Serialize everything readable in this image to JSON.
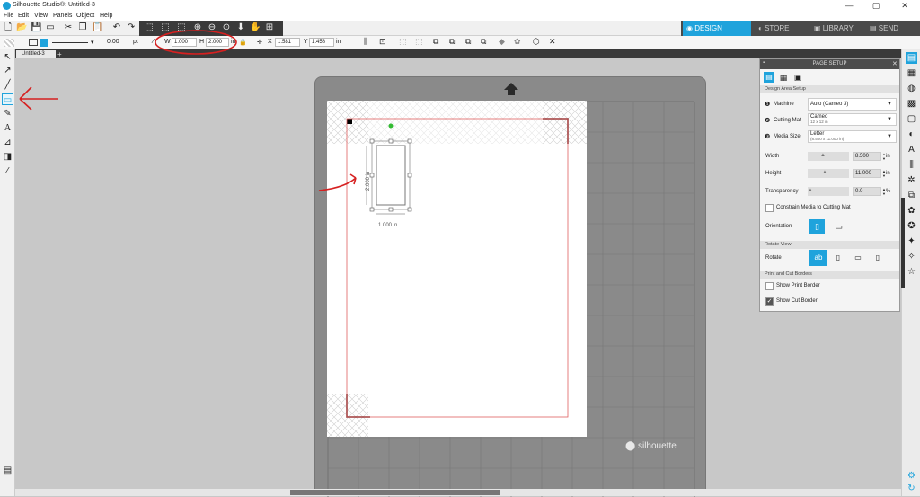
{
  "window": {
    "title": "Silhouette Studio®: Untitled-3",
    "controls": [
      "—",
      "▢",
      "✕"
    ]
  },
  "menu": [
    "File",
    "Edit",
    "View",
    "Panels",
    "Object",
    "Help"
  ],
  "nav_tabs": [
    {
      "label": "DESIGN",
      "active": true
    },
    {
      "label": "STORE",
      "active": false
    },
    {
      "label": "LIBRARY",
      "active": false
    },
    {
      "label": "SEND",
      "active": false
    }
  ],
  "toolbar2": {
    "line_width": "0.00",
    "line_unit": "pt",
    "w_label": "W",
    "w_value": "1.000",
    "h_label": "H",
    "h_value": "2.000",
    "size_unit": "in",
    "x_label": "X",
    "x_value": "1.581",
    "y_label": "Y",
    "y_value": "1.458",
    "pos_unit": "in"
  },
  "doc_tab": "Untitled-3",
  "canvas": {
    "height_label": "2.000 in",
    "width_label": "1.000 in",
    "brand": "silhouette"
  },
  "panel": {
    "title": "PAGE SETUP",
    "section_design": "Design Area Setup",
    "machine_label": "Machine",
    "machine_value": "Auto (Cameo 3)",
    "mat_label": "Cutting Mat",
    "mat_value": "Cameo",
    "mat_sub": "12 x 12 in",
    "media_label": "Media Size",
    "media_value": "Letter",
    "media_sub": "(8.500 x 11.000 in)",
    "width_label": "Width",
    "width_value": "8.500",
    "height_label": "Height",
    "height_value": "11.000",
    "unit": "in",
    "transparency_label": "Transparency",
    "transparency_value": "0.0",
    "transparency_unit": "%",
    "constrain_label": "Constrain Media to Cutting Mat",
    "orientation_label": "Orientation",
    "section_rotate": "Rotate View",
    "rotate_label": "Rotate",
    "section_print": "Print and Cut Borders",
    "show_print_label": "Show Print Border",
    "show_cut_label": "Show Cut Border",
    "show_print_checked": false,
    "show_cut_checked": true
  },
  "colors": {
    "accent": "#1fa3dc",
    "annotation": "#d62020",
    "cut_border": "#e06060"
  }
}
